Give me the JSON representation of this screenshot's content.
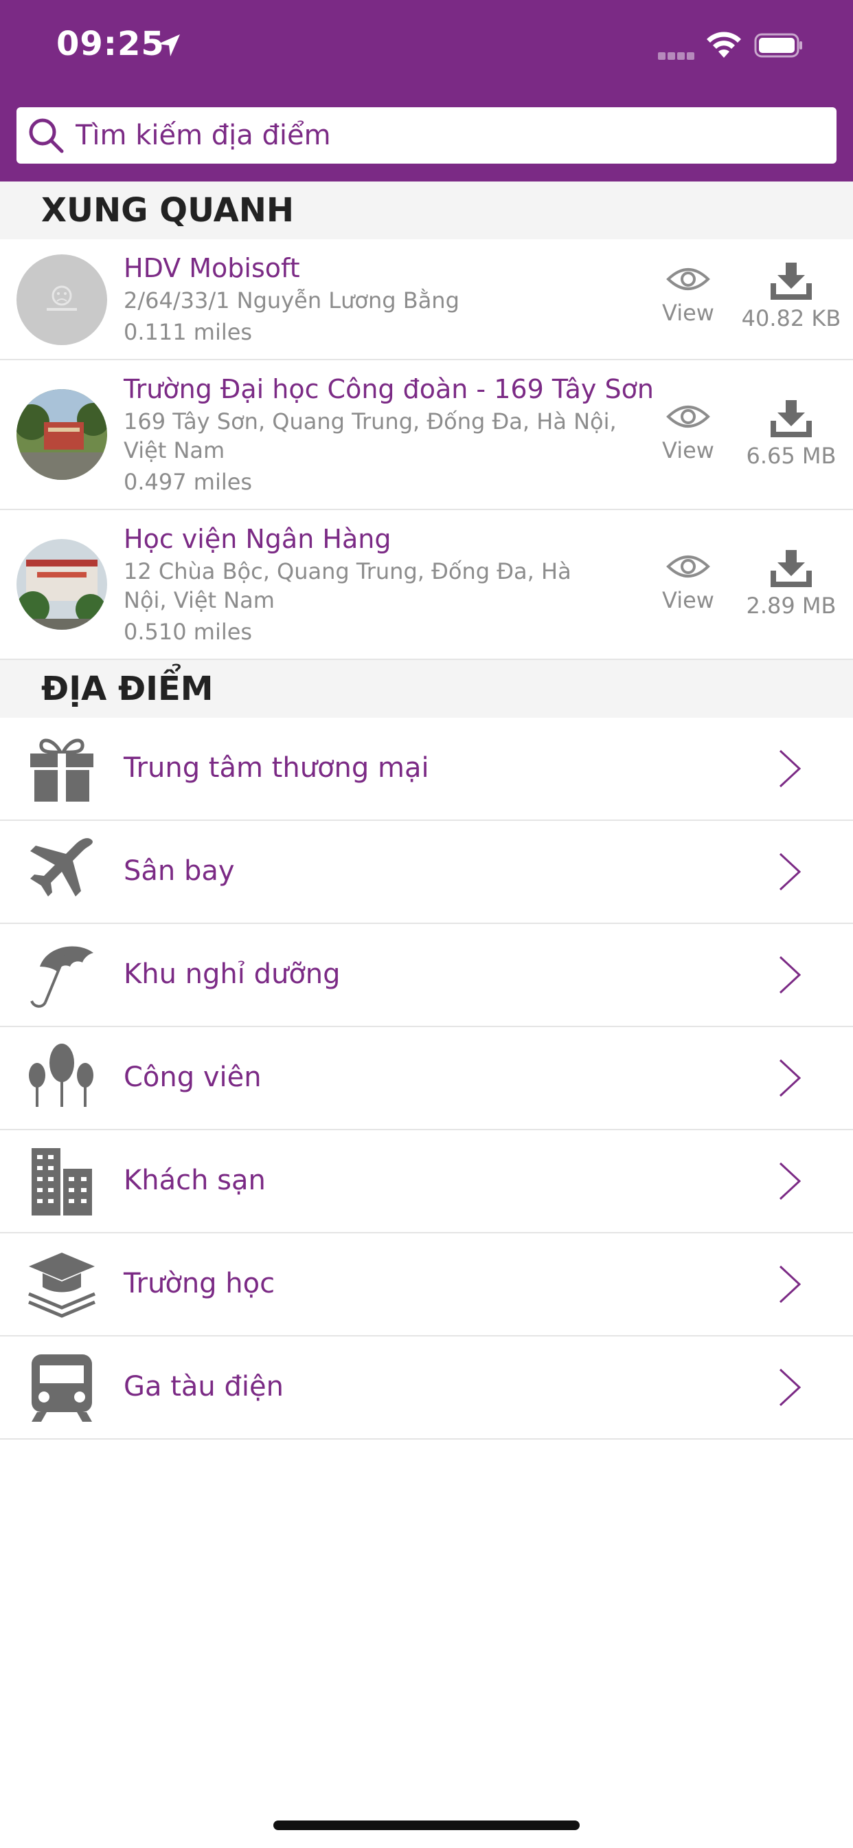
{
  "status_bar": {
    "time": "09:25"
  },
  "search": {
    "placeholder": "Tìm kiếm địa điểm"
  },
  "nearby": {
    "heading": "XUNG QUANH",
    "items": [
      {
        "title": "HDV Mobisoft",
        "address": "2/64/33/1 Nguyễn Lương Bằng",
        "distance": "0.111 miles",
        "view_label": "View",
        "size": "40.82 KB"
      },
      {
        "title": "Trường Đại học Công đoàn - 169 Tây Sơn",
        "address": "169 Tây Sơn, Quang Trung, Đống Đa, Hà Nội, Việt Nam",
        "distance": "0.497 miles",
        "view_label": "View",
        "size": "6.65 MB"
      },
      {
        "title": "Học viện Ngân Hàng",
        "address": "12 Chùa Bộc, Quang Trung, Đống Đa, Hà Nội, Việt Nam",
        "distance": "0.510 miles",
        "view_label": "View",
        "size": "2.89 MB"
      }
    ]
  },
  "places": {
    "heading": "ĐỊA ĐIỂM",
    "items": [
      {
        "label": "Trung tâm thương mại",
        "icon": "gift-icon"
      },
      {
        "label": "Sân bay",
        "icon": "airplane-icon"
      },
      {
        "label": "Khu nghỉ dưỡng",
        "icon": "umbrella-icon"
      },
      {
        "label": "Công viên",
        "icon": "trees-icon"
      },
      {
        "label": "Khách sạn",
        "icon": "buildings-icon"
      },
      {
        "label": "Trường học",
        "icon": "graduation-cap-icon"
      },
      {
        "label": "Ga tàu điện",
        "icon": "train-icon"
      }
    ]
  },
  "colors": {
    "accent": "#7b2a85",
    "icon_gray": "#6b6b6b",
    "text_gray": "#8c8c8c",
    "section_bg": "#f4f4f4"
  }
}
